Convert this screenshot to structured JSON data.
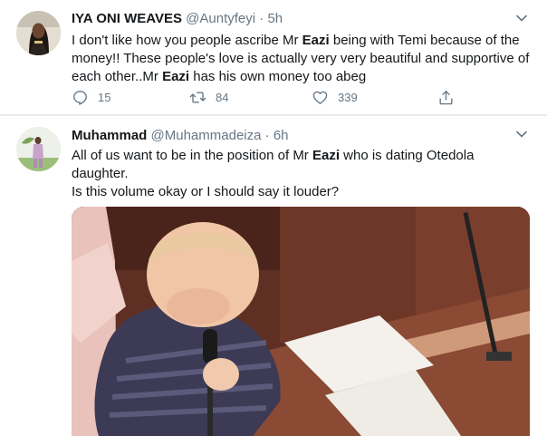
{
  "tweets": [
    {
      "display_name": "IYA ONI WEAVES",
      "handle": "@Auntyfeyi",
      "separator": "·",
      "time": "5h",
      "text_lines": [
        [
          "I don't like how you people ascribe Mr ",
          "Eazi",
          " being with Temi because of the"
        ],
        [
          "money!! These people's love is actually very very beautiful and supportive of"
        ],
        [
          "each other..Mr ",
          "Eazi",
          " has his own money too abeg"
        ]
      ],
      "replies": "15",
      "retweets": "84",
      "likes": "339"
    },
    {
      "display_name": "Muhammad",
      "handle": "@Muhammadeiza",
      "separator": "·",
      "time": "6h",
      "text_lines": [
        [
          "All of us want to be in the position of Mr ",
          "Eazi",
          " who is dating Otedola"
        ],
        [
          "daughter."
        ],
        [
          "Is this volume okay or I should say it louder?"
        ]
      ]
    }
  ],
  "icons": {
    "reply": "reply-icon",
    "retweet": "retweet-icon",
    "like": "heart-icon",
    "share": "share-icon",
    "caret": "chevron-down-icon"
  },
  "colors": {
    "text": "#14171a",
    "secondary": "#657786",
    "divider": "#e6ecf0"
  }
}
